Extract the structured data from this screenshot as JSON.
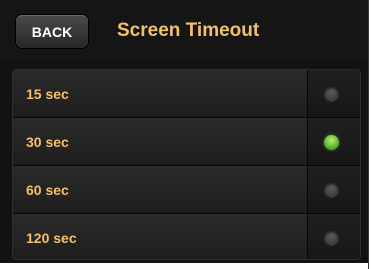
{
  "header": {
    "back_label": "BACK",
    "title": "Screen Timeout"
  },
  "options": [
    {
      "label": "15 sec",
      "selected": false
    },
    {
      "label": "30 sec",
      "selected": true
    },
    {
      "label": "60 sec",
      "selected": false
    },
    {
      "label": "120 sec",
      "selected": false
    }
  ],
  "colors": {
    "accent_text": "#f3c06a",
    "selected_indicator": "#5cc832",
    "background": "#121212"
  },
  "icons": {
    "unselected": "radio-off-icon",
    "selected": "radio-on-icon"
  }
}
